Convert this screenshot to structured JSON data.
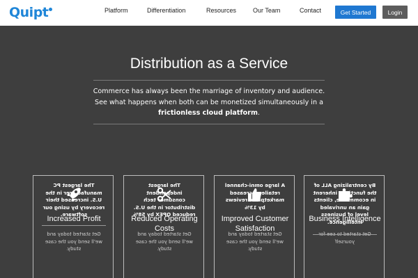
{
  "nav": {
    "logo": "Quipt",
    "links": [
      "Platform",
      "Differentiation",
      "Resources",
      "Our Team",
      "Contact"
    ],
    "get_started": "Get Started",
    "login": "Login"
  },
  "hero": {
    "title": "Distribution as a Service",
    "text_line1": "Commerce has always been the marriage of inventory and audience.",
    "text_line2": "See what happens when both can be monetized simultaneously in a",
    "text_bold": "frictionless cloud platform",
    "text_end": "."
  },
  "cards": [
    {
      "icon": "rocket-icon",
      "title": "Increased Profit",
      "back_text": "The largest PC manufacturer in the U.S. increased their recovery by using our software.",
      "back_sub": "Get started today and we'll send you the case study."
    },
    {
      "icon": "scissors-icon",
      "title": "Reduced Operating Costs",
      "back_text": "The largest independent consumer tech distributor in the U.S. reduced OPEX by 58%",
      "back_sub": "Get started today and we'll send you the case study."
    },
    {
      "icon": "thumbs-up-icon",
      "title": "Improved Customer Satisfaction",
      "back_text": "A large omni-channel retailer increased marketplace reviews by 13%",
      "back_sub": "Get started today and we'll send you the case study."
    },
    {
      "icon": "puzzle-icon",
      "title": "Business Intelligence",
      "back_text": "By centralizing ALL of the functions inherent in ecommerce, clients gain an unrivaled level of business intelligence.",
      "back_sub": "Get started to see for yourself"
    }
  ],
  "colors": {
    "brand": "#1f86d8",
    "button_primary": "#1f78d1",
    "button_secondary": "#5c5c5c",
    "background": "#3e3e3e"
  }
}
